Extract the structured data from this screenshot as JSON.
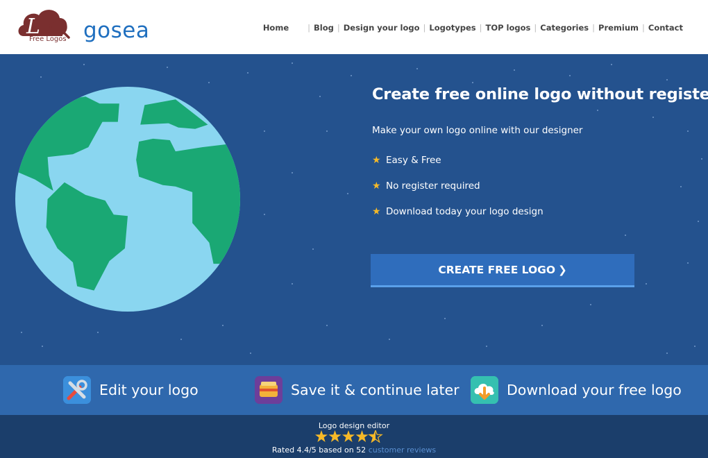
{
  "header": {
    "logo_text": "Logosea",
    "logo_tagline": "Free Logos",
    "nav": [
      {
        "label": "Home"
      },
      {
        "label": "Blog"
      },
      {
        "label": "Design your logo"
      },
      {
        "label": "Logotypes"
      },
      {
        "label": "TOP logos"
      },
      {
        "label": "Categories"
      },
      {
        "label": "Premium"
      },
      {
        "label": "Contact"
      }
    ]
  },
  "hero": {
    "title": "Create free online logo without register",
    "subtitle": "Make your own logo online with our designer",
    "features": [
      {
        "label": "Easy & Free",
        "icon": "star-icon"
      },
      {
        "label": "No register required",
        "icon": "star-icon"
      },
      {
        "label": "Download today your logo design",
        "icon": "star-icon"
      }
    ],
    "cta_label": "CREATE FREE LOGO",
    "cta_chevron": "❯"
  },
  "feature_bar": [
    {
      "label": "Edit your logo",
      "icon": "tools-icon"
    },
    {
      "label": "Save it & continue later",
      "icon": "wallet-icon"
    },
    {
      "label": "Download your free logo",
      "icon": "cloud-download-icon"
    }
  ],
  "footer": {
    "rating_title": "Logo design editor",
    "rating_value": 4.4,
    "rating_prefix": "Rated 4.4/5 based on 52",
    "rating_link": "customer reviews"
  },
  "colors": {
    "hero_bg": "#24528e",
    "feature_bar_bg": "#2f68ad",
    "footer_bg": "#1b3e6b",
    "cta_bg": "#2f6dbc",
    "star": "#f6b928",
    "ocean": "#8ad6f0",
    "land": "#1aa874",
    "logo_blue": "#1f6fbf",
    "logo_maroon": "#7a2f2f"
  }
}
